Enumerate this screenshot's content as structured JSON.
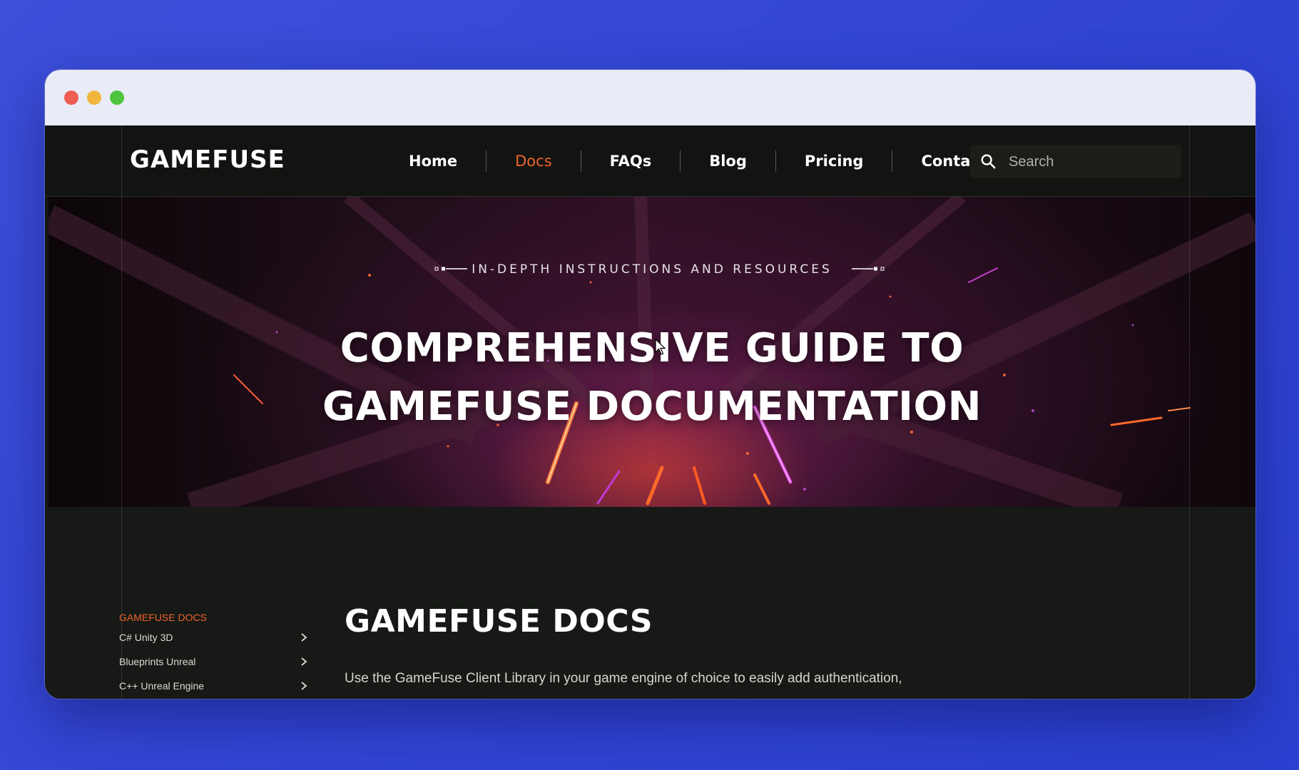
{
  "window": {
    "controls": [
      "close",
      "minimize",
      "maximize"
    ]
  },
  "header": {
    "logo": "GAMEFUSE",
    "nav": [
      {
        "label": "Home",
        "active": false
      },
      {
        "label": "Docs",
        "active": true
      },
      {
        "label": "FAQs",
        "active": false
      },
      {
        "label": "Blog",
        "active": false
      },
      {
        "label": "Pricing",
        "active": false
      },
      {
        "label": "Contact",
        "active": false
      }
    ],
    "search": {
      "placeholder": "Search",
      "value": "",
      "icon": "search-icon"
    }
  },
  "hero": {
    "eyebrow": "IN-DEPTH INSTRUCTIONS AND RESOURCES",
    "title_line1": "COMPREHENSIVE GUIDE TO",
    "title_line2": "GAMEFUSE DOCUMENTATION"
  },
  "sidebar": {
    "heading": "GAMEFUSE DOCS",
    "items": [
      {
        "label": "C# Unity 3D",
        "icon": "chevron-right-icon"
      },
      {
        "label": "Blueprints Unreal",
        "icon": "chevron-right-icon"
      },
      {
        "label": "C++ Unreal Engine",
        "icon": "chevron-right-icon"
      }
    ]
  },
  "main": {
    "title": "GAMEFUSE DOCS",
    "intro": "Use the GameFuse Client Library in your game engine of choice to easily add authentication,"
  },
  "colors": {
    "accent": "#f0642a",
    "background": "#141612",
    "desktop": "#3346d6"
  }
}
